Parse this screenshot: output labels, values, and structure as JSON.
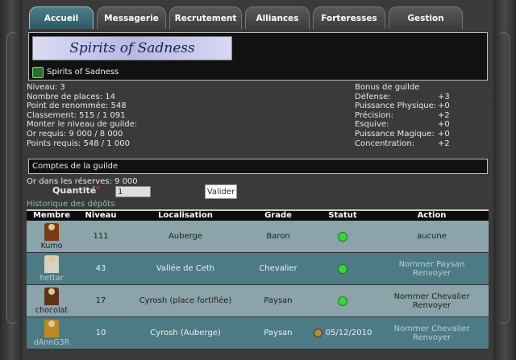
{
  "tabs": [
    "Accueil",
    "Messagerie",
    "Recrutement",
    "Alliances",
    "Forteresses",
    "Gestion"
  ],
  "guild": {
    "banner_text": "Spirits of Sadness",
    "name": "Spirits of Sadness"
  },
  "stats": [
    "Niveau: 3",
    "Nombre de places: 14",
    "Point de renommée: 548",
    "Classement: 515 / 1 091",
    "Monter le niveau de guilde:",
    "Or requis: 9 000 / 8 000",
    "Points requis: 548 / 1 000"
  ],
  "bonus": {
    "title": "Bonus de guilde",
    "rows": [
      {
        "label": "Défense:",
        "value": "+3"
      },
      {
        "label": "Puissance Physique:",
        "value": "+0"
      },
      {
        "label": "Précision:",
        "value": "+2"
      },
      {
        "label": "Esquive:",
        "value": "+0"
      },
      {
        "label": "Puissance Magique:",
        "value": "+0"
      },
      {
        "label": "Concentration:",
        "value": "+2"
      }
    ]
  },
  "accounts": {
    "title": "Comptes de la guilde",
    "reserves": "Or dans les réserves: 9 000",
    "quantity_label": "Quantité",
    "required_mark": "*",
    "quantity_value": "1",
    "validate_label": "Valider",
    "history_link": "Historique des dépôts"
  },
  "table": {
    "headers": [
      "Membre",
      "Niveau",
      "Localisation",
      "Grade",
      "Statut",
      "Action"
    ],
    "rows": [
      {
        "member": "Kumo",
        "level": "111",
        "location": "Auberge",
        "grade": "Baron",
        "status_text": "",
        "actions": [
          "aucune"
        ]
      },
      {
        "member": "hettar",
        "level": "43",
        "location": "Vallée de Ceth",
        "grade": "Chevalier",
        "status_text": "",
        "actions": [
          "Nommer Paysan",
          "Renvoyer"
        ]
      },
      {
        "member": "chocolat",
        "level": "17",
        "location": "Cyrosh (place fortifiée)",
        "grade": "Paysan",
        "status_text": "",
        "actions": [
          "Nommer Chevalier",
          "Renvoyer"
        ]
      },
      {
        "member": "dAnnG3R",
        "level": "10",
        "location": "Cyrosh (Auberge)",
        "grade": "Paysan",
        "status_text": "05/12/2010",
        "actions": [
          "Nommer Chevalier",
          "Renvoyer"
        ]
      }
    ]
  },
  "colors": {
    "active_tab": "#4c7f89",
    "row_light": "#8aa4a9",
    "row_dark": "#4d7b85",
    "online": "#3fd13f"
  }
}
